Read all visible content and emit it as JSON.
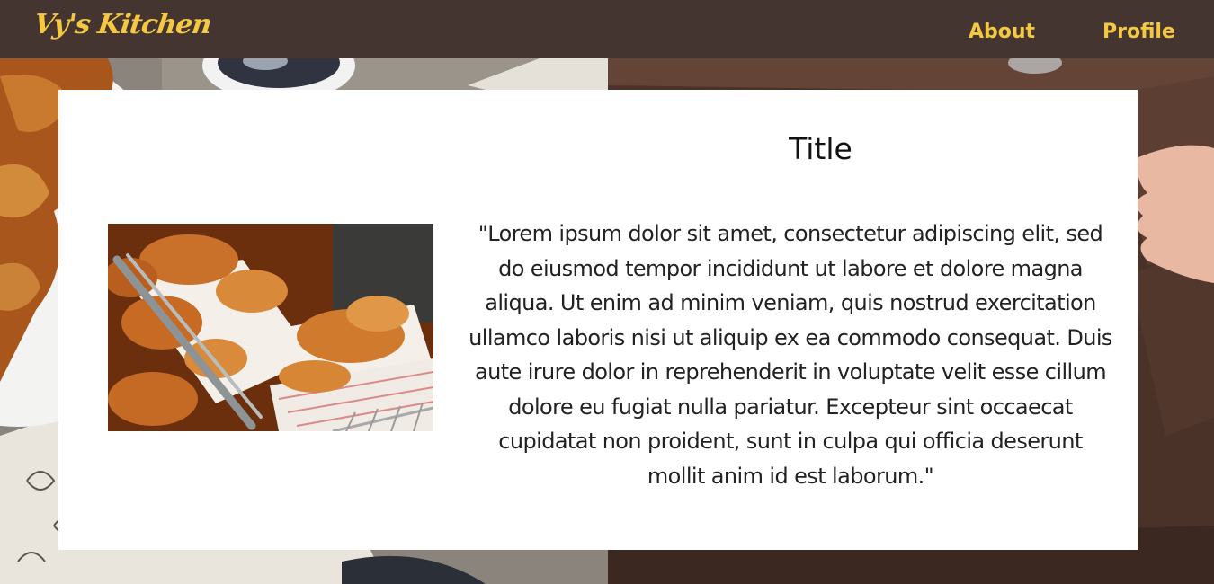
{
  "navbar": {
    "logo": "Vy's Kitchen",
    "links": [
      {
        "label": "About"
      },
      {
        "label": "Profile"
      }
    ],
    "colors": {
      "background": "#453531",
      "accent": "#f5c842"
    }
  },
  "card": {
    "title": "Title",
    "body": "\"Lorem ipsum dolor sit amet, consectetur adipiscing elit, sed do eiusmod tempor incididunt ut labore et dolore magna aliqua. Ut enim ad minim veniam, quis nostrud exercitation ullamco laboris nisi ut aliquip ex ea commodo consequat. Duis aute irure dolor in reprehenderit in voluptate velit esse cillum dolore eu fugiat nulla pariatur. Excepteur sint occaecat cupidatat non proident, sunt in culpa qui officia deserunt mollit anim id est laborum.\""
  }
}
